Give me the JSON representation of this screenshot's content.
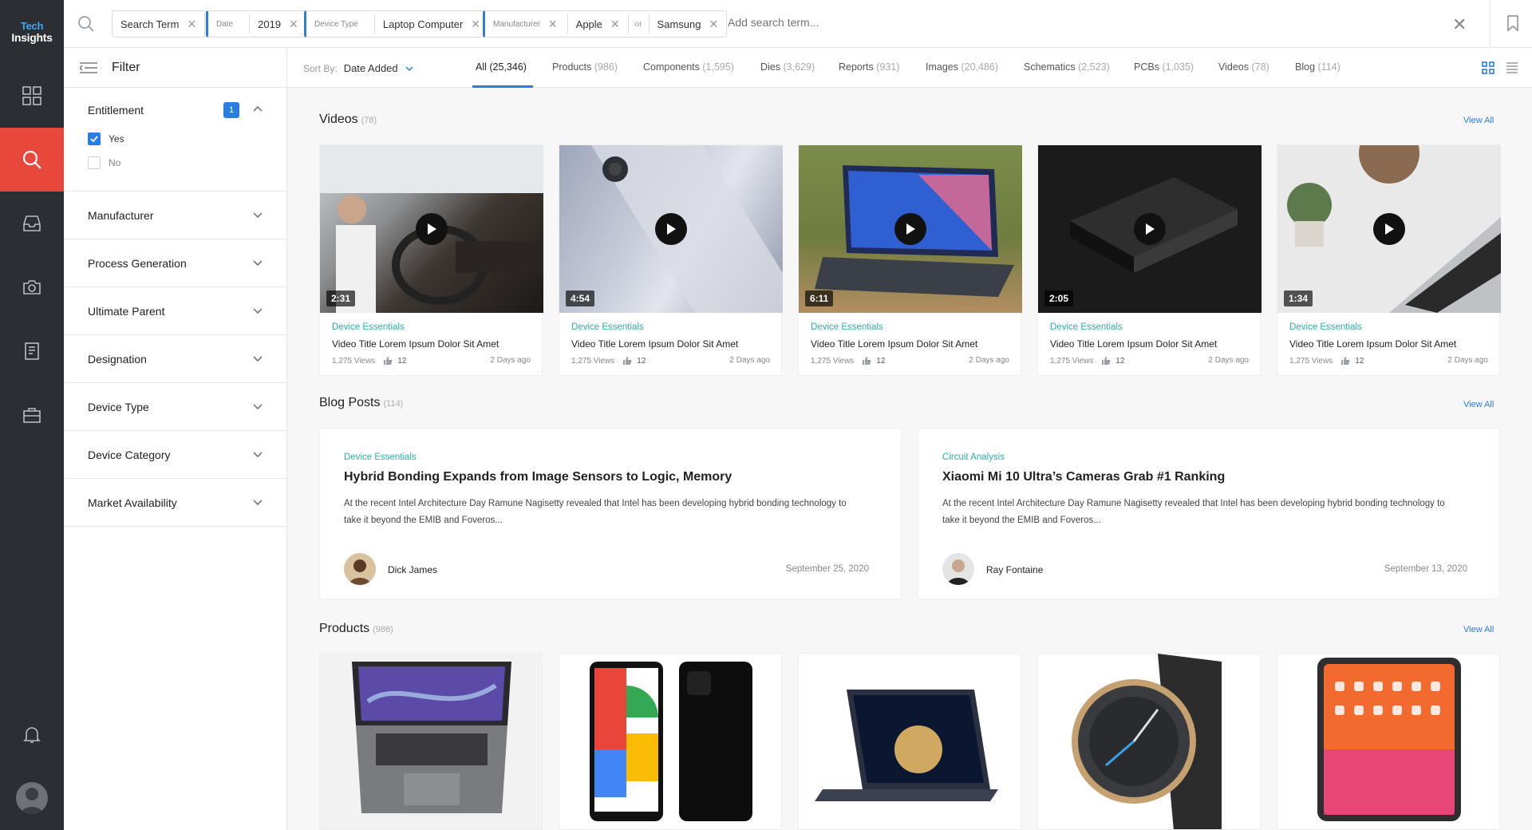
{
  "brand": {
    "logo_line1": "Tech",
    "logo_line2": "Insights"
  },
  "rail": {
    "items": [
      {
        "name": "dashboard",
        "icon": "grid-icon"
      },
      {
        "name": "search",
        "icon": "search-icon",
        "active": true
      },
      {
        "name": "inbox",
        "icon": "inbox-icon"
      },
      {
        "name": "camera",
        "icon": "camera-icon"
      },
      {
        "name": "reports",
        "icon": "document-icon"
      },
      {
        "name": "briefcase",
        "icon": "briefcase-icon"
      },
      {
        "name": "notifications",
        "icon": "bell-icon"
      }
    ]
  },
  "search": {
    "chips": [
      {
        "value": "Search Term"
      },
      {
        "label": "Date",
        "value": "2019"
      },
      {
        "label": "Device Type",
        "value": "Laptop Computer"
      },
      {
        "label": "Manufacturer",
        "values": [
          "Apple",
          "Samsung"
        ],
        "joiner": "or"
      }
    ],
    "placeholder": "Add search term..."
  },
  "filter": {
    "title": "Filter",
    "entitlement": {
      "label": "Entitlement",
      "badge": "1",
      "options": [
        {
          "label": "Yes",
          "checked": true
        },
        {
          "label": "No",
          "checked": false
        }
      ]
    },
    "facets": [
      "Manufacturer",
      "Process Generation",
      "Ultimate Parent",
      "Designation",
      "Device Type",
      "Device Category",
      "Market Availability"
    ]
  },
  "sort": {
    "label": "Sort By:",
    "value": "Date Added"
  },
  "tabs": [
    {
      "label": "All",
      "count": "(25,346)",
      "active": true
    },
    {
      "label": "Products",
      "count": "(986)"
    },
    {
      "label": "Components",
      "count": "(1,595)"
    },
    {
      "label": "Dies",
      "count": "(3,629)"
    },
    {
      "label": "Reports",
      "count": "(931)"
    },
    {
      "label": "Images",
      "count": "(20,486)"
    },
    {
      "label": "Schematics",
      "count": "(2,523)"
    },
    {
      "label": "PCBs",
      "count": "(1,035)"
    },
    {
      "label": "Videos",
      "count": "(78)"
    },
    {
      "label": "Blog",
      "count": "(114)"
    }
  ],
  "sections": {
    "videos": {
      "title": "Videos",
      "count": "(78)",
      "view_all": "View All"
    },
    "blog": {
      "title": "Blog Posts",
      "count": "(114)",
      "view_all": "View All"
    },
    "products": {
      "title": "Products",
      "count": "(986)",
      "view_all": "View All"
    }
  },
  "videos": [
    {
      "duration": "2:31",
      "category": "Device Essentials",
      "title": "Video Title Lorem Ipsum Dolor Sit Amet",
      "views": "1,275 Views",
      "likes": "12",
      "date": "2 Days ago"
    },
    {
      "duration": "4:54",
      "category": "Device Essentials",
      "title": "Video Title Lorem Ipsum Dolor Sit Amet",
      "views": "1,275 Views",
      "likes": "12",
      "date": "2 Days ago"
    },
    {
      "duration": "6:11",
      "category": "Device Essentials",
      "title": "Video Title Lorem Ipsum Dolor Sit Amet",
      "views": "1,275 Views",
      "likes": "12",
      "date": "2 Days ago"
    },
    {
      "duration": "2:05",
      "category": "Device Essentials",
      "title": "Video Title Lorem Ipsum Dolor Sit Amet",
      "views": "1,275 Views",
      "likes": "12",
      "date": "2 Days ago"
    },
    {
      "duration": "1:34",
      "category": "Device Essentials",
      "title": "Video Title Lorem Ipsum Dolor Sit Amet",
      "views": "1,275 Views",
      "likes": "12",
      "date": "2 Days ago"
    }
  ],
  "posts": [
    {
      "category": "Device Essentials",
      "title": "Hybrid Bonding Expands from Image Sensors to Logic, Memory",
      "excerpt": "At the recent Intel Architecture Day Ramune Nagisetty revealed that Intel has been developing hybrid bonding technology to take it beyond the EMIB and Foveros...",
      "author": "Dick James",
      "date": "September 25, 2020"
    },
    {
      "category": "Circuit Analysis",
      "title": "Xiaomi Mi 10 Ultra’s Cameras Grab #1 Ranking",
      "excerpt": "At the recent Intel Architecture Day Ramune Nagisetty revealed that Intel has been developing hybrid bonding technology to take it beyond the EMIB and Foveros...",
      "author": "Ray Fontaine",
      "date": "September 13, 2020"
    }
  ],
  "colors": {
    "accent": "#2a7de1",
    "active_rail": "#e8473c",
    "category": "#2bb0a4",
    "rail_bg": "#2b2e33"
  }
}
